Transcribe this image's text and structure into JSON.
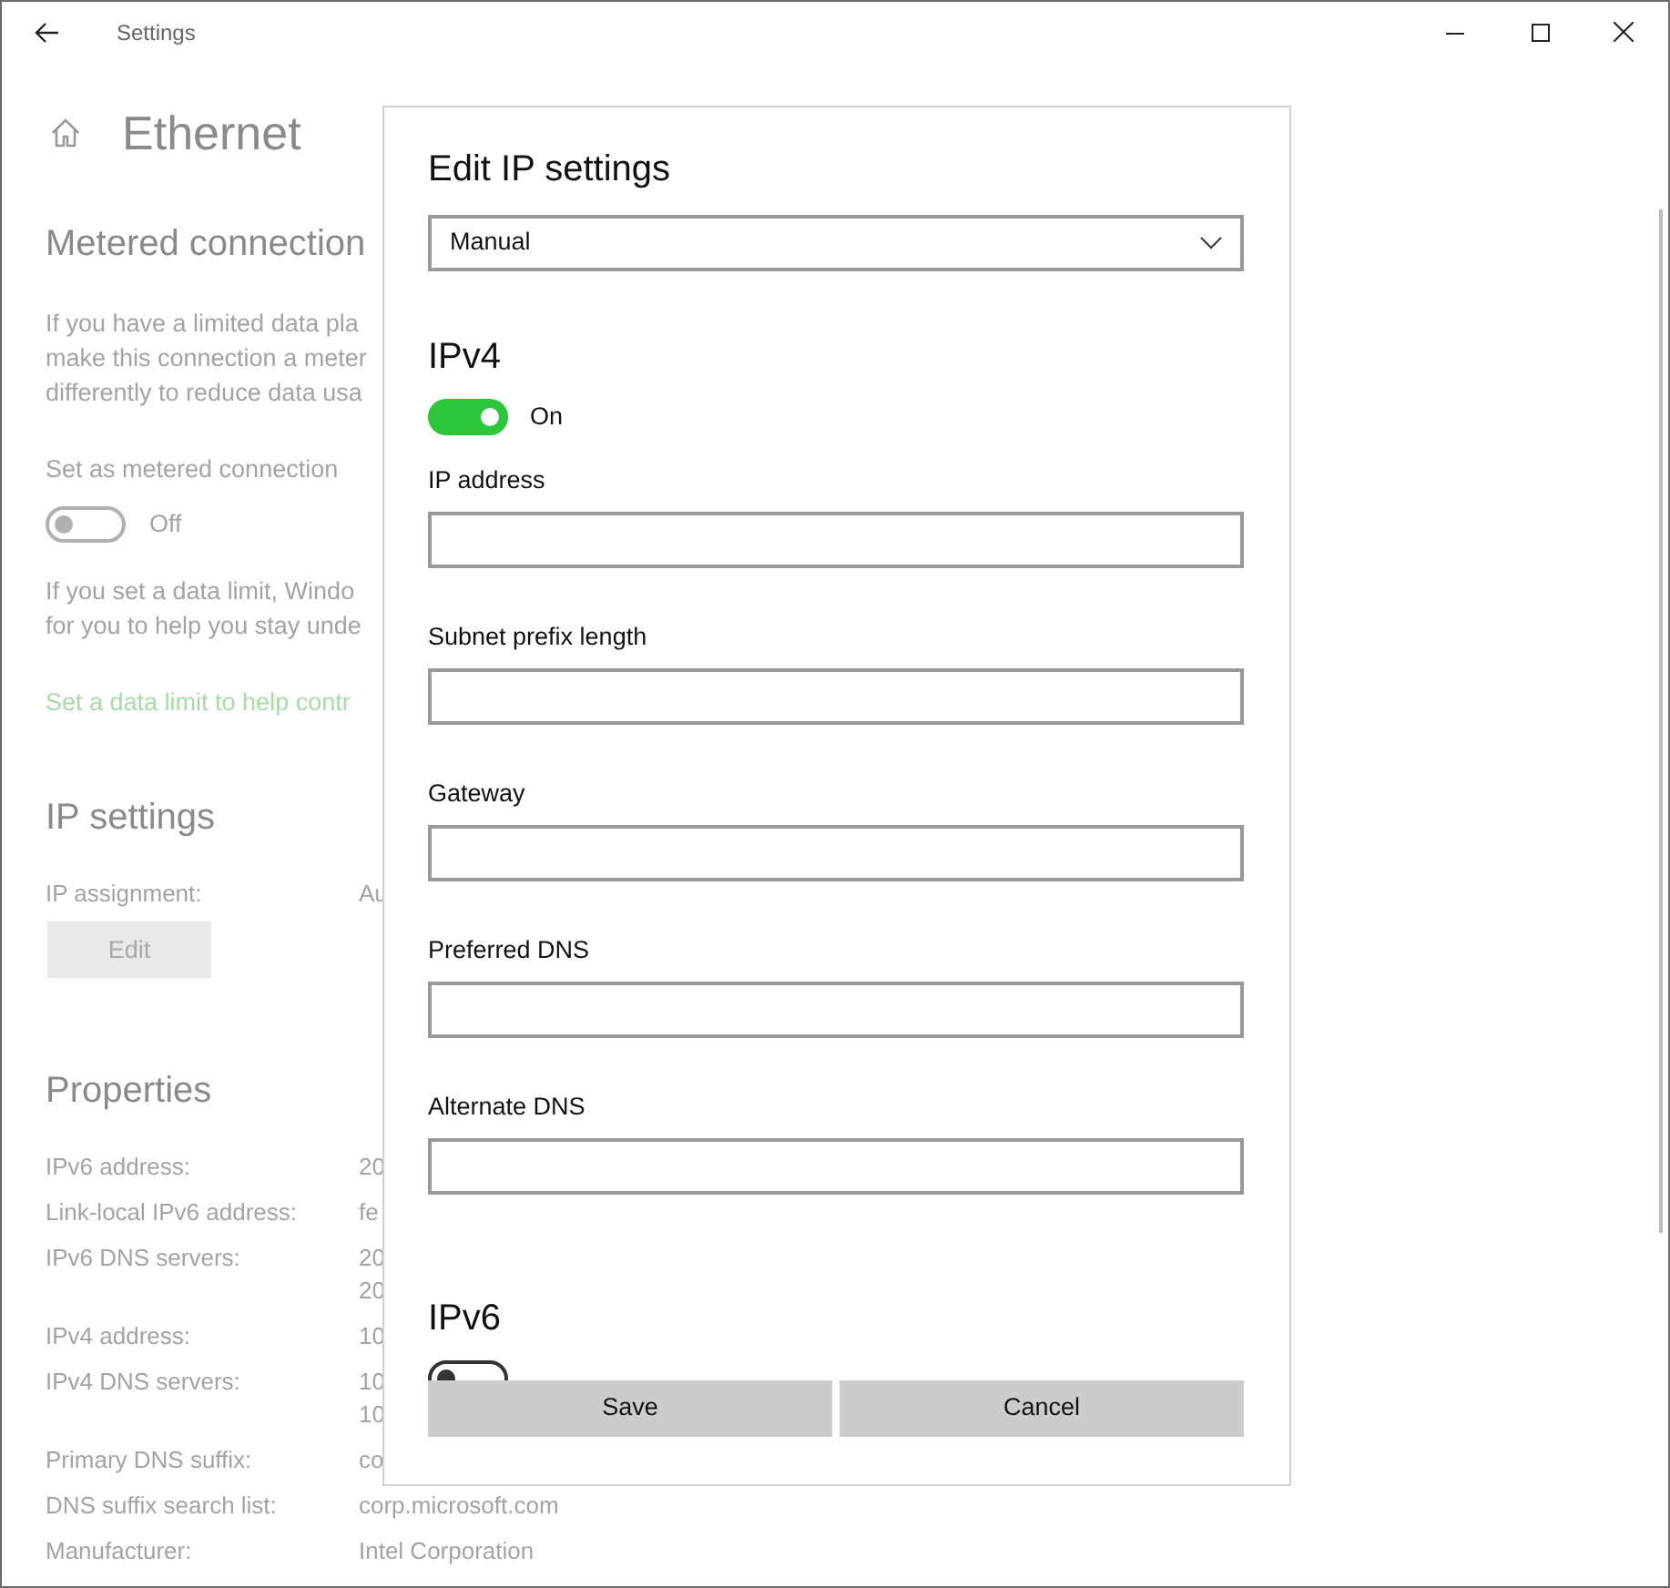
{
  "window": {
    "title": "Settings"
  },
  "page": {
    "title": "Ethernet"
  },
  "metered": {
    "heading": "Metered connection",
    "description": [
      "If you have a limited data pla",
      "make this connection a meter",
      "differently to reduce data usa"
    ],
    "toggle_caption": "Set as metered connection",
    "toggle": {
      "on": false,
      "label": "Off"
    },
    "note": [
      "If you set a data limit, Windo",
      "for you to help you stay unde"
    ],
    "link": "Set a data limit to help contr"
  },
  "ip_settings": {
    "heading": "IP settings",
    "assignment_label": "IP assignment:",
    "assignment_value": "Au",
    "edit_button": "Edit"
  },
  "properties": {
    "heading": "Properties",
    "rows": [
      {
        "label": "IPv6 address:",
        "values": [
          "20"
        ]
      },
      {
        "label": "Link-local IPv6 address:",
        "values": [
          "fe"
        ]
      },
      {
        "label": "IPv6 DNS servers:",
        "values": [
          "20",
          "20"
        ]
      },
      {
        "label": "IPv4 address:",
        "values": [
          "10"
        ]
      },
      {
        "label": "IPv4 DNS servers:",
        "values": [
          "10",
          "10"
        ]
      },
      {
        "label": "Primary DNS suffix:",
        "values": [
          "co"
        ]
      },
      {
        "label": "DNS suffix search list:",
        "values": [
          "corp.microsoft.com"
        ]
      },
      {
        "label": "Manufacturer:",
        "values": [
          "Intel Corporation"
        ]
      }
    ]
  },
  "dialog": {
    "title": "Edit IP settings",
    "mode": "Manual",
    "sections": [
      {
        "heading": "IPv4",
        "toggle": {
          "on": true,
          "label": "On"
        },
        "fields": [
          {
            "label": "IP address"
          },
          {
            "label": "Subnet prefix length"
          },
          {
            "label": "Gateway"
          },
          {
            "label": "Preferred DNS"
          },
          {
            "label": "Alternate DNS"
          }
        ]
      },
      {
        "heading": "IPv6",
        "toggle": {
          "on": false
        }
      }
    ],
    "buttons": [
      "Save",
      "Cancel"
    ]
  }
}
